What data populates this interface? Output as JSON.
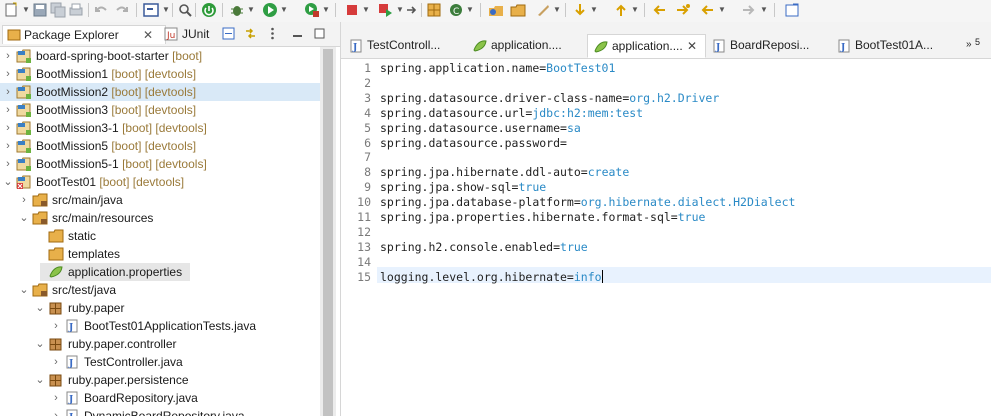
{
  "package_explorer": {
    "tab_label": "Package Explorer",
    "junit_tab_label": "JUnit",
    "items": [
      {
        "label": "board-spring-boot-starter",
        "decor": "[boot]",
        "arrow": "›",
        "icon": "boot-project-icon"
      },
      {
        "label": "BootMission1",
        "decor": "[boot] [devtools]",
        "arrow": "›",
        "icon": "boot-project-icon"
      },
      {
        "label": "BootMission2",
        "decor": "[boot] [devtools]",
        "arrow": "›",
        "icon": "boot-project-icon"
      },
      {
        "label": "BootMission3",
        "decor": "[boot] [devtools]",
        "arrow": "›",
        "icon": "boot-project-icon"
      },
      {
        "label": "BootMission3-1",
        "decor": "[boot] [devtools]",
        "arrow": "›",
        "icon": "boot-project-icon"
      },
      {
        "label": "BootMission5",
        "decor": "[boot] [devtools]",
        "arrow": "›",
        "icon": "boot-project-icon"
      },
      {
        "label": "BootMission5-1",
        "decor": "[boot] [devtools]",
        "arrow": "›",
        "icon": "boot-project-icon"
      },
      {
        "label": "BootTest01",
        "decor": "[boot] [devtools]",
        "arrow": "⌄",
        "icon": "boot-project-error-icon"
      },
      {
        "label": "src/main/java",
        "decor": "",
        "arrow": "›",
        "icon": "source-folder-icon"
      },
      {
        "label": "src/main/resources",
        "decor": "",
        "arrow": "⌄",
        "icon": "source-folder-icon"
      },
      {
        "label": "static",
        "decor": "",
        "arrow": "",
        "icon": "folder-icon"
      },
      {
        "label": "templates",
        "decor": "",
        "arrow": "",
        "icon": "folder-icon"
      },
      {
        "label": "application.properties",
        "decor": "",
        "arrow": "",
        "icon": "properties-file-icon"
      },
      {
        "label": "src/test/java",
        "decor": "",
        "arrow": "⌄",
        "icon": "source-folder-icon"
      },
      {
        "label": "ruby.paper",
        "decor": "",
        "arrow": "⌄",
        "icon": "package-icon"
      },
      {
        "label": "BootTest01ApplicationTests.java",
        "decor": "",
        "arrow": "›",
        "icon": "java-file-icon"
      },
      {
        "label": "ruby.paper.controller",
        "decor": "",
        "arrow": "⌄",
        "icon": "package-icon"
      },
      {
        "label": "TestController.java",
        "decor": "",
        "arrow": "›",
        "icon": "java-file-icon"
      },
      {
        "label": "ruby.paper.persistence",
        "decor": "",
        "arrow": "⌄",
        "icon": "package-icon"
      },
      {
        "label": "BoardRepository.java",
        "decor": "",
        "arrow": "›",
        "icon": "java-file-icon"
      },
      {
        "label": "DynamicBoardRepository.java",
        "decor": "",
        "arrow": "›",
        "icon": "java-file-icon"
      }
    ]
  },
  "editor": {
    "tabs": [
      {
        "label": "TestControll...",
        "icon": "java-file-icon",
        "active": false
      },
      {
        "label": "application....",
        "icon": "properties-file-icon",
        "active": false
      },
      {
        "label": "application....",
        "icon": "properties-file-icon",
        "active": true
      },
      {
        "label": "BoardReposi...",
        "icon": "java-file-icon",
        "active": false
      },
      {
        "label": "BootTest01A...",
        "icon": "java-file-icon",
        "active": false
      }
    ],
    "overflow_count": "5",
    "lines": [
      {
        "n": "1",
        "key": "spring.application.name=",
        "val": "BootTest01"
      },
      {
        "n": "2",
        "key": "",
        "val": ""
      },
      {
        "n": "3",
        "key": "spring.datasource.driver-class-name=",
        "val": "org.h2.Driver"
      },
      {
        "n": "4",
        "key": "spring.datasource.url=",
        "val": "jdbc:h2:mem:test"
      },
      {
        "n": "5",
        "key": "spring.datasource.username=",
        "val": "sa"
      },
      {
        "n": "6",
        "key": "spring.datasource.password=",
        "val": ""
      },
      {
        "n": "7",
        "key": "",
        "val": ""
      },
      {
        "n": "8",
        "key": "spring.jpa.hibernate.ddl-auto=",
        "val": "create"
      },
      {
        "n": "9",
        "key": "spring.jpa.show-sql=",
        "val": "true"
      },
      {
        "n": "10",
        "key": "spring.jpa.database-platform=",
        "val": "org.hibernate.dialect.H2Dialect"
      },
      {
        "n": "11",
        "key": "spring.jpa.properties.hibernate.format-sql=",
        "val": "true"
      },
      {
        "n": "12",
        "key": "",
        "val": ""
      },
      {
        "n": "13",
        "key": "spring.h2.console.enabled=",
        "val": "true"
      },
      {
        "n": "14",
        "key": "",
        "val": ""
      },
      {
        "n": "15",
        "key": "logging.level.org.hibernate=",
        "val": "info"
      }
    ]
  },
  "colors": {
    "value_text": "#2a8ac6",
    "selection_row": "#d9e9f7",
    "current_line": "#e8f2fe"
  }
}
